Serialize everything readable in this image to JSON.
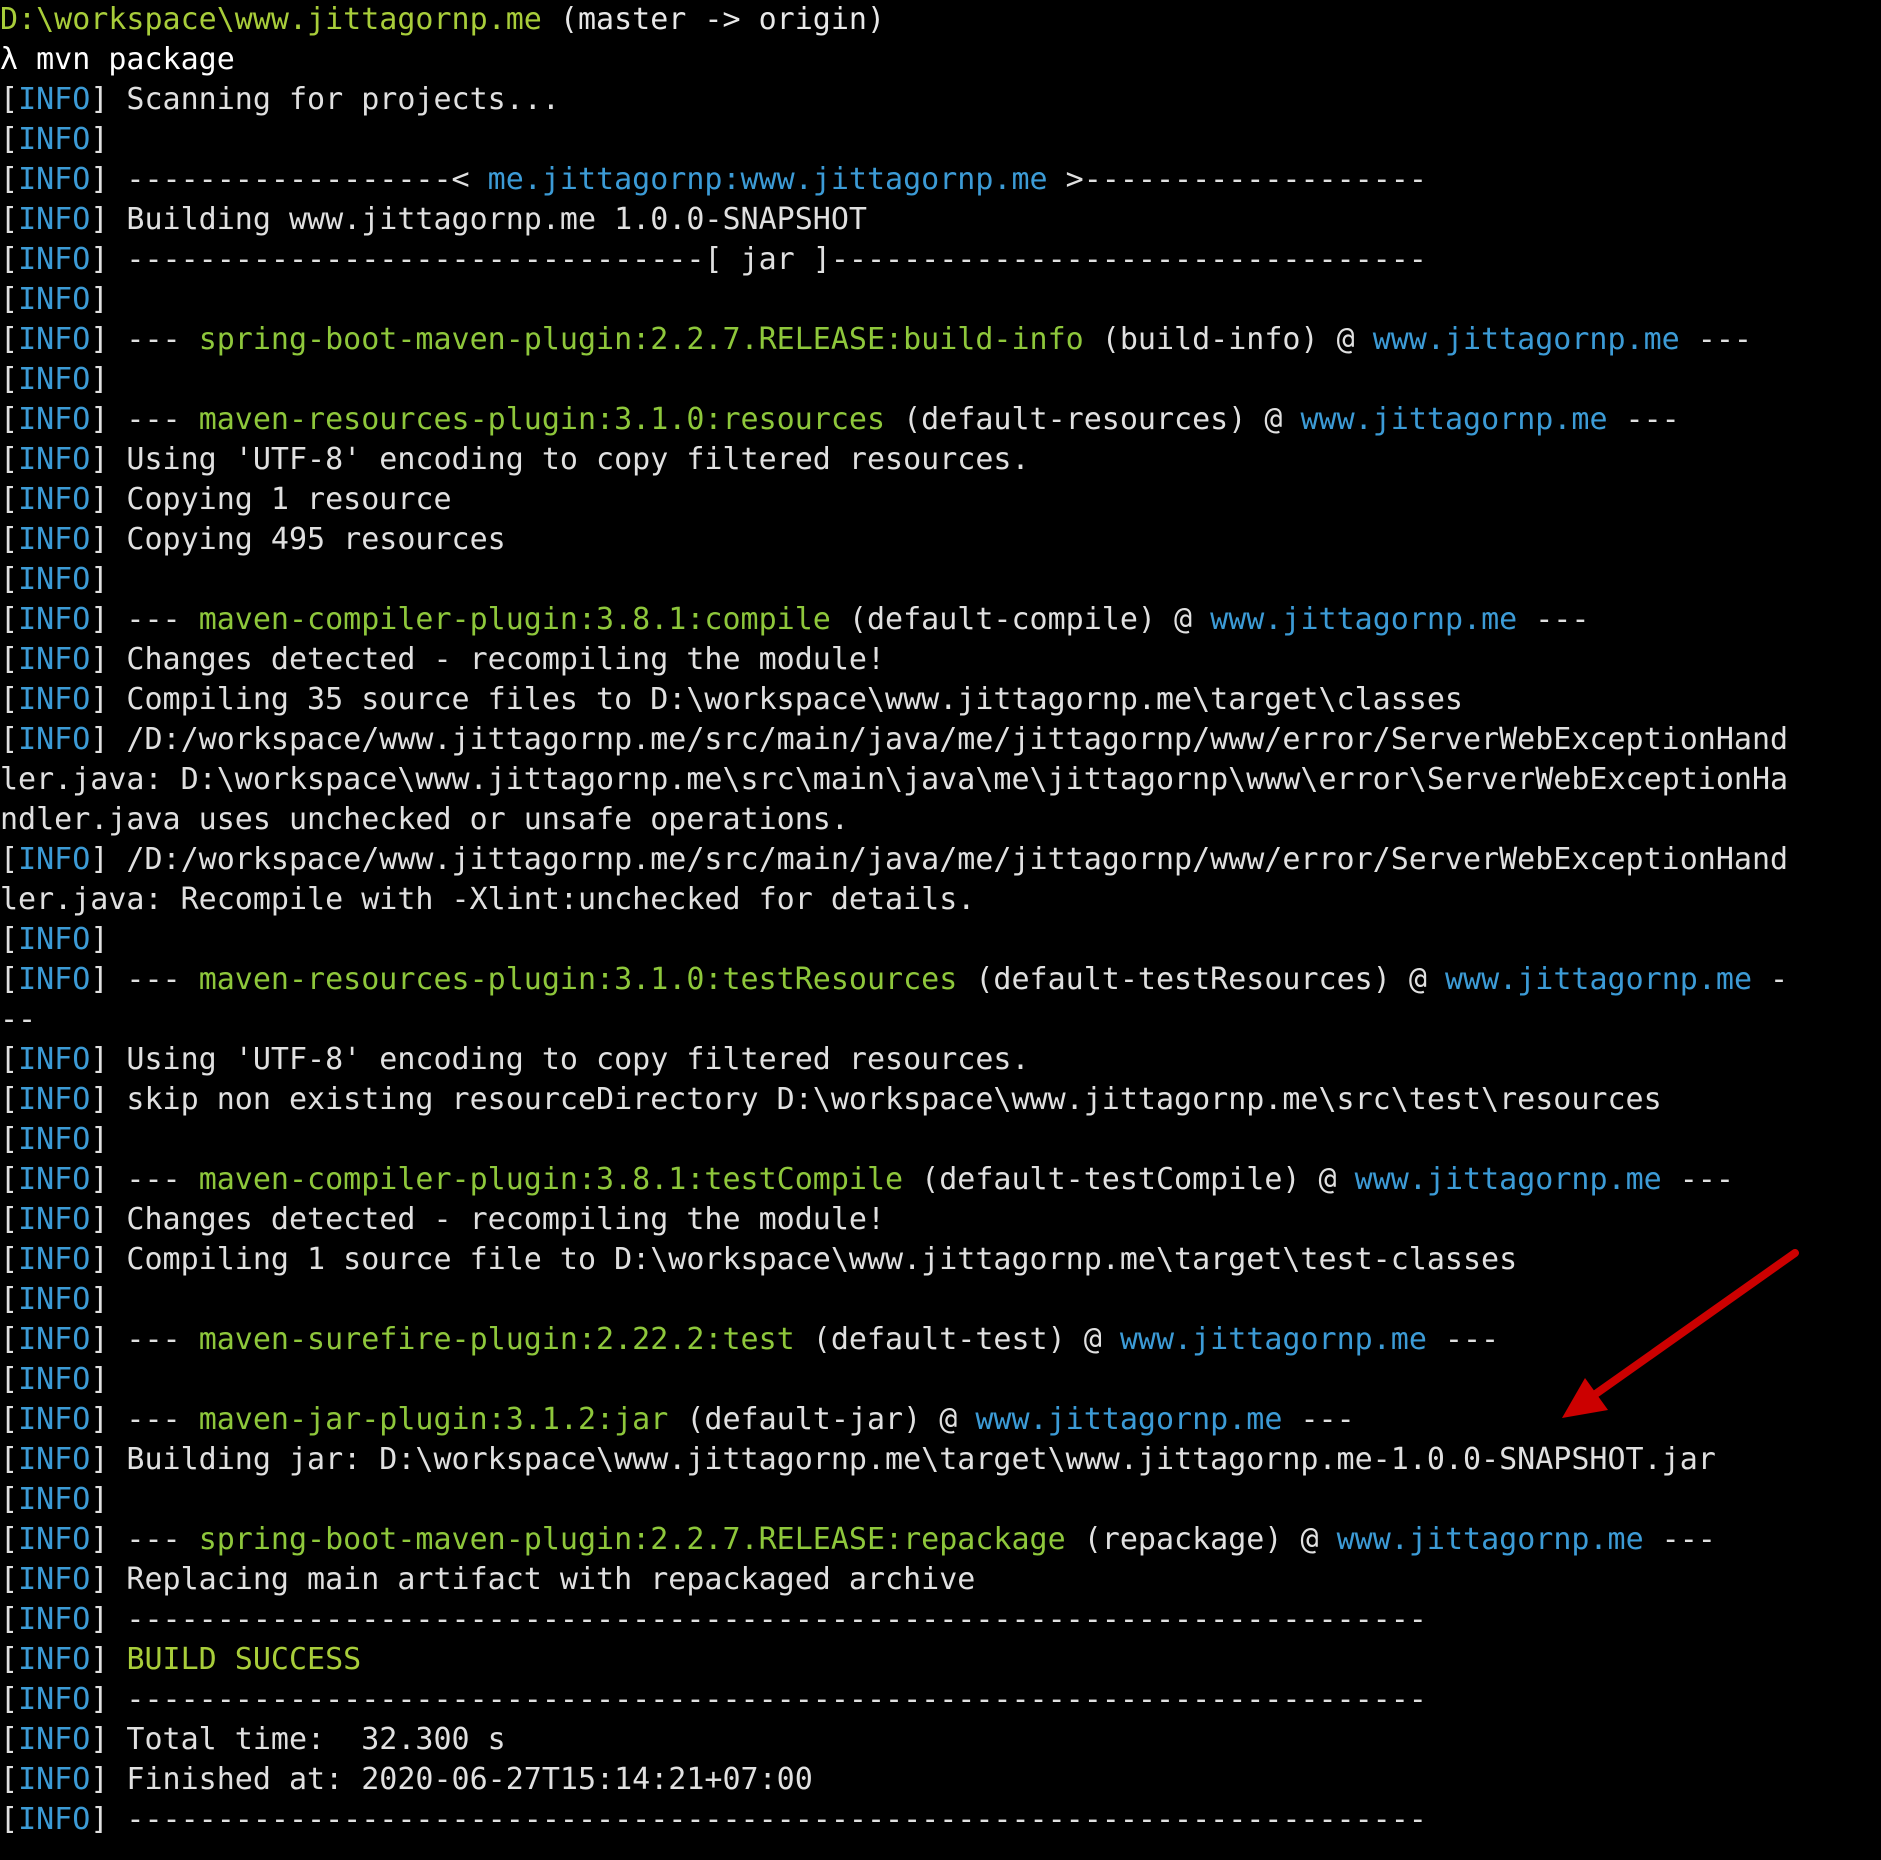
{
  "terminal": {
    "lines": [
      [
        {
          "t": "D:\\workspace\\www.jittagornp.me ",
          "c": "path"
        },
        {
          "t": "(master -> origin)",
          "c": "branch"
        }
      ],
      [
        {
          "t": "λ mvn package",
          "c": "prompt"
        }
      ],
      [
        {
          "t": "[",
          "c": "plain"
        },
        {
          "t": "INFO",
          "c": "info-tag"
        },
        {
          "t": "] Scanning for projects...",
          "c": "plain"
        }
      ],
      [
        {
          "t": "[",
          "c": "plain"
        },
        {
          "t": "INFO",
          "c": "info-tag"
        },
        {
          "t": "]",
          "c": "plain"
        }
      ],
      [
        {
          "t": "[",
          "c": "plain"
        },
        {
          "t": "INFO",
          "c": "info-tag"
        },
        {
          "t": "] ------------------< ",
          "c": "plain"
        },
        {
          "t": "me.jittagornp:www.jittagornp.me",
          "c": "project"
        },
        {
          "t": " >-------------------",
          "c": "plain"
        }
      ],
      [
        {
          "t": "[",
          "c": "plain"
        },
        {
          "t": "INFO",
          "c": "info-tag"
        },
        {
          "t": "] Building www.jittagornp.me 1.0.0-SNAPSHOT",
          "c": "plain"
        }
      ],
      [
        {
          "t": "[",
          "c": "plain"
        },
        {
          "t": "INFO",
          "c": "info-tag"
        },
        {
          "t": "] --------------------------------[ jar ]---------------------------------",
          "c": "plain"
        }
      ],
      [
        {
          "t": "[",
          "c": "plain"
        },
        {
          "t": "INFO",
          "c": "info-tag"
        },
        {
          "t": "]",
          "c": "plain"
        }
      ],
      [
        {
          "t": "[",
          "c": "plain"
        },
        {
          "t": "INFO",
          "c": "info-tag"
        },
        {
          "t": "] --- ",
          "c": "plain"
        },
        {
          "t": "spring-boot-maven-plugin:2.2.7.RELEASE:build-info",
          "c": "plugin"
        },
        {
          "t": " (build-info) @ ",
          "c": "plain"
        },
        {
          "t": "www.jittagornp.me",
          "c": "project"
        },
        {
          "t": " ---",
          "c": "plain"
        }
      ],
      [
        {
          "t": "[",
          "c": "plain"
        },
        {
          "t": "INFO",
          "c": "info-tag"
        },
        {
          "t": "]",
          "c": "plain"
        }
      ],
      [
        {
          "t": "[",
          "c": "plain"
        },
        {
          "t": "INFO",
          "c": "info-tag"
        },
        {
          "t": "] --- ",
          "c": "plain"
        },
        {
          "t": "maven-resources-plugin:3.1.0:resources",
          "c": "plugin"
        },
        {
          "t": " (default-resources) @ ",
          "c": "plain"
        },
        {
          "t": "www.jittagornp.me",
          "c": "project"
        },
        {
          "t": " ---",
          "c": "plain"
        }
      ],
      [
        {
          "t": "[",
          "c": "plain"
        },
        {
          "t": "INFO",
          "c": "info-tag"
        },
        {
          "t": "] Using 'UTF-8' encoding to copy filtered resources.",
          "c": "plain"
        }
      ],
      [
        {
          "t": "[",
          "c": "plain"
        },
        {
          "t": "INFO",
          "c": "info-tag"
        },
        {
          "t": "] Copying 1 resource",
          "c": "plain"
        }
      ],
      [
        {
          "t": "[",
          "c": "plain"
        },
        {
          "t": "INFO",
          "c": "info-tag"
        },
        {
          "t": "] Copying 495 resources",
          "c": "plain"
        }
      ],
      [
        {
          "t": "[",
          "c": "plain"
        },
        {
          "t": "INFO",
          "c": "info-tag"
        },
        {
          "t": "]",
          "c": "plain"
        }
      ],
      [
        {
          "t": "[",
          "c": "plain"
        },
        {
          "t": "INFO",
          "c": "info-tag"
        },
        {
          "t": "] --- ",
          "c": "plain"
        },
        {
          "t": "maven-compiler-plugin:3.8.1:compile",
          "c": "plugin"
        },
        {
          "t": " (default-compile) @ ",
          "c": "plain"
        },
        {
          "t": "www.jittagornp.me",
          "c": "project"
        },
        {
          "t": " ---",
          "c": "plain"
        }
      ],
      [
        {
          "t": "[",
          "c": "plain"
        },
        {
          "t": "INFO",
          "c": "info-tag"
        },
        {
          "t": "] Changes detected - recompiling the module!",
          "c": "plain"
        }
      ],
      [
        {
          "t": "[",
          "c": "plain"
        },
        {
          "t": "INFO",
          "c": "info-tag"
        },
        {
          "t": "] Compiling 35 source files to D:\\workspace\\www.jittagornp.me\\target\\classes",
          "c": "plain"
        }
      ],
      [
        {
          "t": "[",
          "c": "plain"
        },
        {
          "t": "INFO",
          "c": "info-tag"
        },
        {
          "t": "] /D:/workspace/www.jittagornp.me/src/main/java/me/jittagornp/www/error/ServerWebExceptionHand",
          "c": "plain"
        }
      ],
      [
        {
          "t": "ler.java: D:\\workspace\\www.jittagornp.me\\src\\main\\java\\me\\jittagornp\\www\\error\\ServerWebExceptionHa",
          "c": "plain"
        }
      ],
      [
        {
          "t": "ndler.java uses unchecked or unsafe operations.",
          "c": "plain"
        }
      ],
      [
        {
          "t": "[",
          "c": "plain"
        },
        {
          "t": "INFO",
          "c": "info-tag"
        },
        {
          "t": "] /D:/workspace/www.jittagornp.me/src/main/java/me/jittagornp/www/error/ServerWebExceptionHand",
          "c": "plain"
        }
      ],
      [
        {
          "t": "ler.java: Recompile with -Xlint:unchecked for details.",
          "c": "plain"
        }
      ],
      [
        {
          "t": "[",
          "c": "plain"
        },
        {
          "t": "INFO",
          "c": "info-tag"
        },
        {
          "t": "]",
          "c": "plain"
        }
      ],
      [
        {
          "t": "[",
          "c": "plain"
        },
        {
          "t": "INFO",
          "c": "info-tag"
        },
        {
          "t": "] --- ",
          "c": "plain"
        },
        {
          "t": "maven-resources-plugin:3.1.0:testResources",
          "c": "plugin"
        },
        {
          "t": " (default-testResources) @ ",
          "c": "plain"
        },
        {
          "t": "www.jittagornp.me",
          "c": "project"
        },
        {
          "t": " -",
          "c": "plain"
        }
      ],
      [
        {
          "t": "--",
          "c": "plain"
        }
      ],
      [
        {
          "t": "[",
          "c": "plain"
        },
        {
          "t": "INFO",
          "c": "info-tag"
        },
        {
          "t": "] Using 'UTF-8' encoding to copy filtered resources.",
          "c": "plain"
        }
      ],
      [
        {
          "t": "[",
          "c": "plain"
        },
        {
          "t": "INFO",
          "c": "info-tag"
        },
        {
          "t": "] skip non existing resourceDirectory D:\\workspace\\www.jittagornp.me\\src\\test\\resources",
          "c": "plain"
        }
      ],
      [
        {
          "t": "[",
          "c": "plain"
        },
        {
          "t": "INFO",
          "c": "info-tag"
        },
        {
          "t": "]",
          "c": "plain"
        }
      ],
      [
        {
          "t": "[",
          "c": "plain"
        },
        {
          "t": "INFO",
          "c": "info-tag"
        },
        {
          "t": "] --- ",
          "c": "plain"
        },
        {
          "t": "maven-compiler-plugin:3.8.1:testCompile",
          "c": "plugin"
        },
        {
          "t": " (default-testCompile) @ ",
          "c": "plain"
        },
        {
          "t": "www.jittagornp.me",
          "c": "project"
        },
        {
          "t": " ---",
          "c": "plain"
        }
      ],
      [
        {
          "t": "[",
          "c": "plain"
        },
        {
          "t": "INFO",
          "c": "info-tag"
        },
        {
          "t": "] Changes detected - recompiling the module!",
          "c": "plain"
        }
      ],
      [
        {
          "t": "[",
          "c": "plain"
        },
        {
          "t": "INFO",
          "c": "info-tag"
        },
        {
          "t": "] Compiling 1 source file to D:\\workspace\\www.jittagornp.me\\target\\test-classes",
          "c": "plain"
        }
      ],
      [
        {
          "t": "[",
          "c": "plain"
        },
        {
          "t": "INFO",
          "c": "info-tag"
        },
        {
          "t": "]",
          "c": "plain"
        }
      ],
      [
        {
          "t": "[",
          "c": "plain"
        },
        {
          "t": "INFO",
          "c": "info-tag"
        },
        {
          "t": "] --- ",
          "c": "plain"
        },
        {
          "t": "maven-surefire-plugin:2.22.2:test",
          "c": "plugin"
        },
        {
          "t": " (default-test) @ ",
          "c": "plain"
        },
        {
          "t": "www.jittagornp.me",
          "c": "project"
        },
        {
          "t": " ---",
          "c": "plain"
        }
      ],
      [
        {
          "t": "[",
          "c": "plain"
        },
        {
          "t": "INFO",
          "c": "info-tag"
        },
        {
          "t": "]",
          "c": "plain"
        }
      ],
      [
        {
          "t": "[",
          "c": "plain"
        },
        {
          "t": "INFO",
          "c": "info-tag"
        },
        {
          "t": "] --- ",
          "c": "plain"
        },
        {
          "t": "maven-jar-plugin:3.1.2:jar",
          "c": "plugin"
        },
        {
          "t": " (default-jar) @ ",
          "c": "plain"
        },
        {
          "t": "www.jittagornp.me",
          "c": "project"
        },
        {
          "t": " ---",
          "c": "plain"
        }
      ],
      [
        {
          "t": "[",
          "c": "plain"
        },
        {
          "t": "INFO",
          "c": "info-tag"
        },
        {
          "t": "] Building jar: D:\\workspace\\www.jittagornp.me\\target\\www.jittagornp.me-1.0.0-SNAPSHOT.jar",
          "c": "plain"
        }
      ],
      [
        {
          "t": "[",
          "c": "plain"
        },
        {
          "t": "INFO",
          "c": "info-tag"
        },
        {
          "t": "]",
          "c": "plain"
        }
      ],
      [
        {
          "t": "[",
          "c": "plain"
        },
        {
          "t": "INFO",
          "c": "info-tag"
        },
        {
          "t": "] --- ",
          "c": "plain"
        },
        {
          "t": "spring-boot-maven-plugin:2.2.7.RELEASE:repackage",
          "c": "plugin"
        },
        {
          "t": " (repackage) @ ",
          "c": "plain"
        },
        {
          "t": "www.jittagornp.me",
          "c": "project"
        },
        {
          "t": " ---",
          "c": "plain"
        }
      ],
      [
        {
          "t": "[",
          "c": "plain"
        },
        {
          "t": "INFO",
          "c": "info-tag"
        },
        {
          "t": "] Replacing main artifact with repackaged archive",
          "c": "plain"
        }
      ],
      [
        {
          "t": "[",
          "c": "plain"
        },
        {
          "t": "INFO",
          "c": "info-tag"
        },
        {
          "t": "] ------------------------------------------------------------------------",
          "c": "plain"
        }
      ],
      [
        {
          "t": "[",
          "c": "plain"
        },
        {
          "t": "INFO",
          "c": "info-tag"
        },
        {
          "t": "] ",
          "c": "plain"
        },
        {
          "t": "BUILD SUCCESS",
          "c": "success"
        }
      ],
      [
        {
          "t": "[",
          "c": "plain"
        },
        {
          "t": "INFO",
          "c": "info-tag"
        },
        {
          "t": "] ------------------------------------------------------------------------",
          "c": "plain"
        }
      ],
      [
        {
          "t": "[",
          "c": "plain"
        },
        {
          "t": "INFO",
          "c": "info-tag"
        },
        {
          "t": "] Total time:  32.300 s",
          "c": "plain"
        }
      ],
      [
        {
          "t": "[",
          "c": "plain"
        },
        {
          "t": "INFO",
          "c": "info-tag"
        },
        {
          "t": "] Finished at: 2020-06-27T15:14:21+07:00",
          "c": "plain"
        }
      ],
      [
        {
          "t": "[",
          "c": "plain"
        },
        {
          "t": "INFO",
          "c": "info-tag"
        },
        {
          "t": "] ------------------------------------------------------------------------",
          "c": "plain"
        }
      ]
    ]
  },
  "annotation": {
    "arrow_color": "#cc0000",
    "arrow_icon": "red-arrow-icon"
  },
  "colors": {
    "background": "#000000",
    "info": "#3c9bd6",
    "plugin": "#8ec73b",
    "success": "#a8cd3a"
  }
}
